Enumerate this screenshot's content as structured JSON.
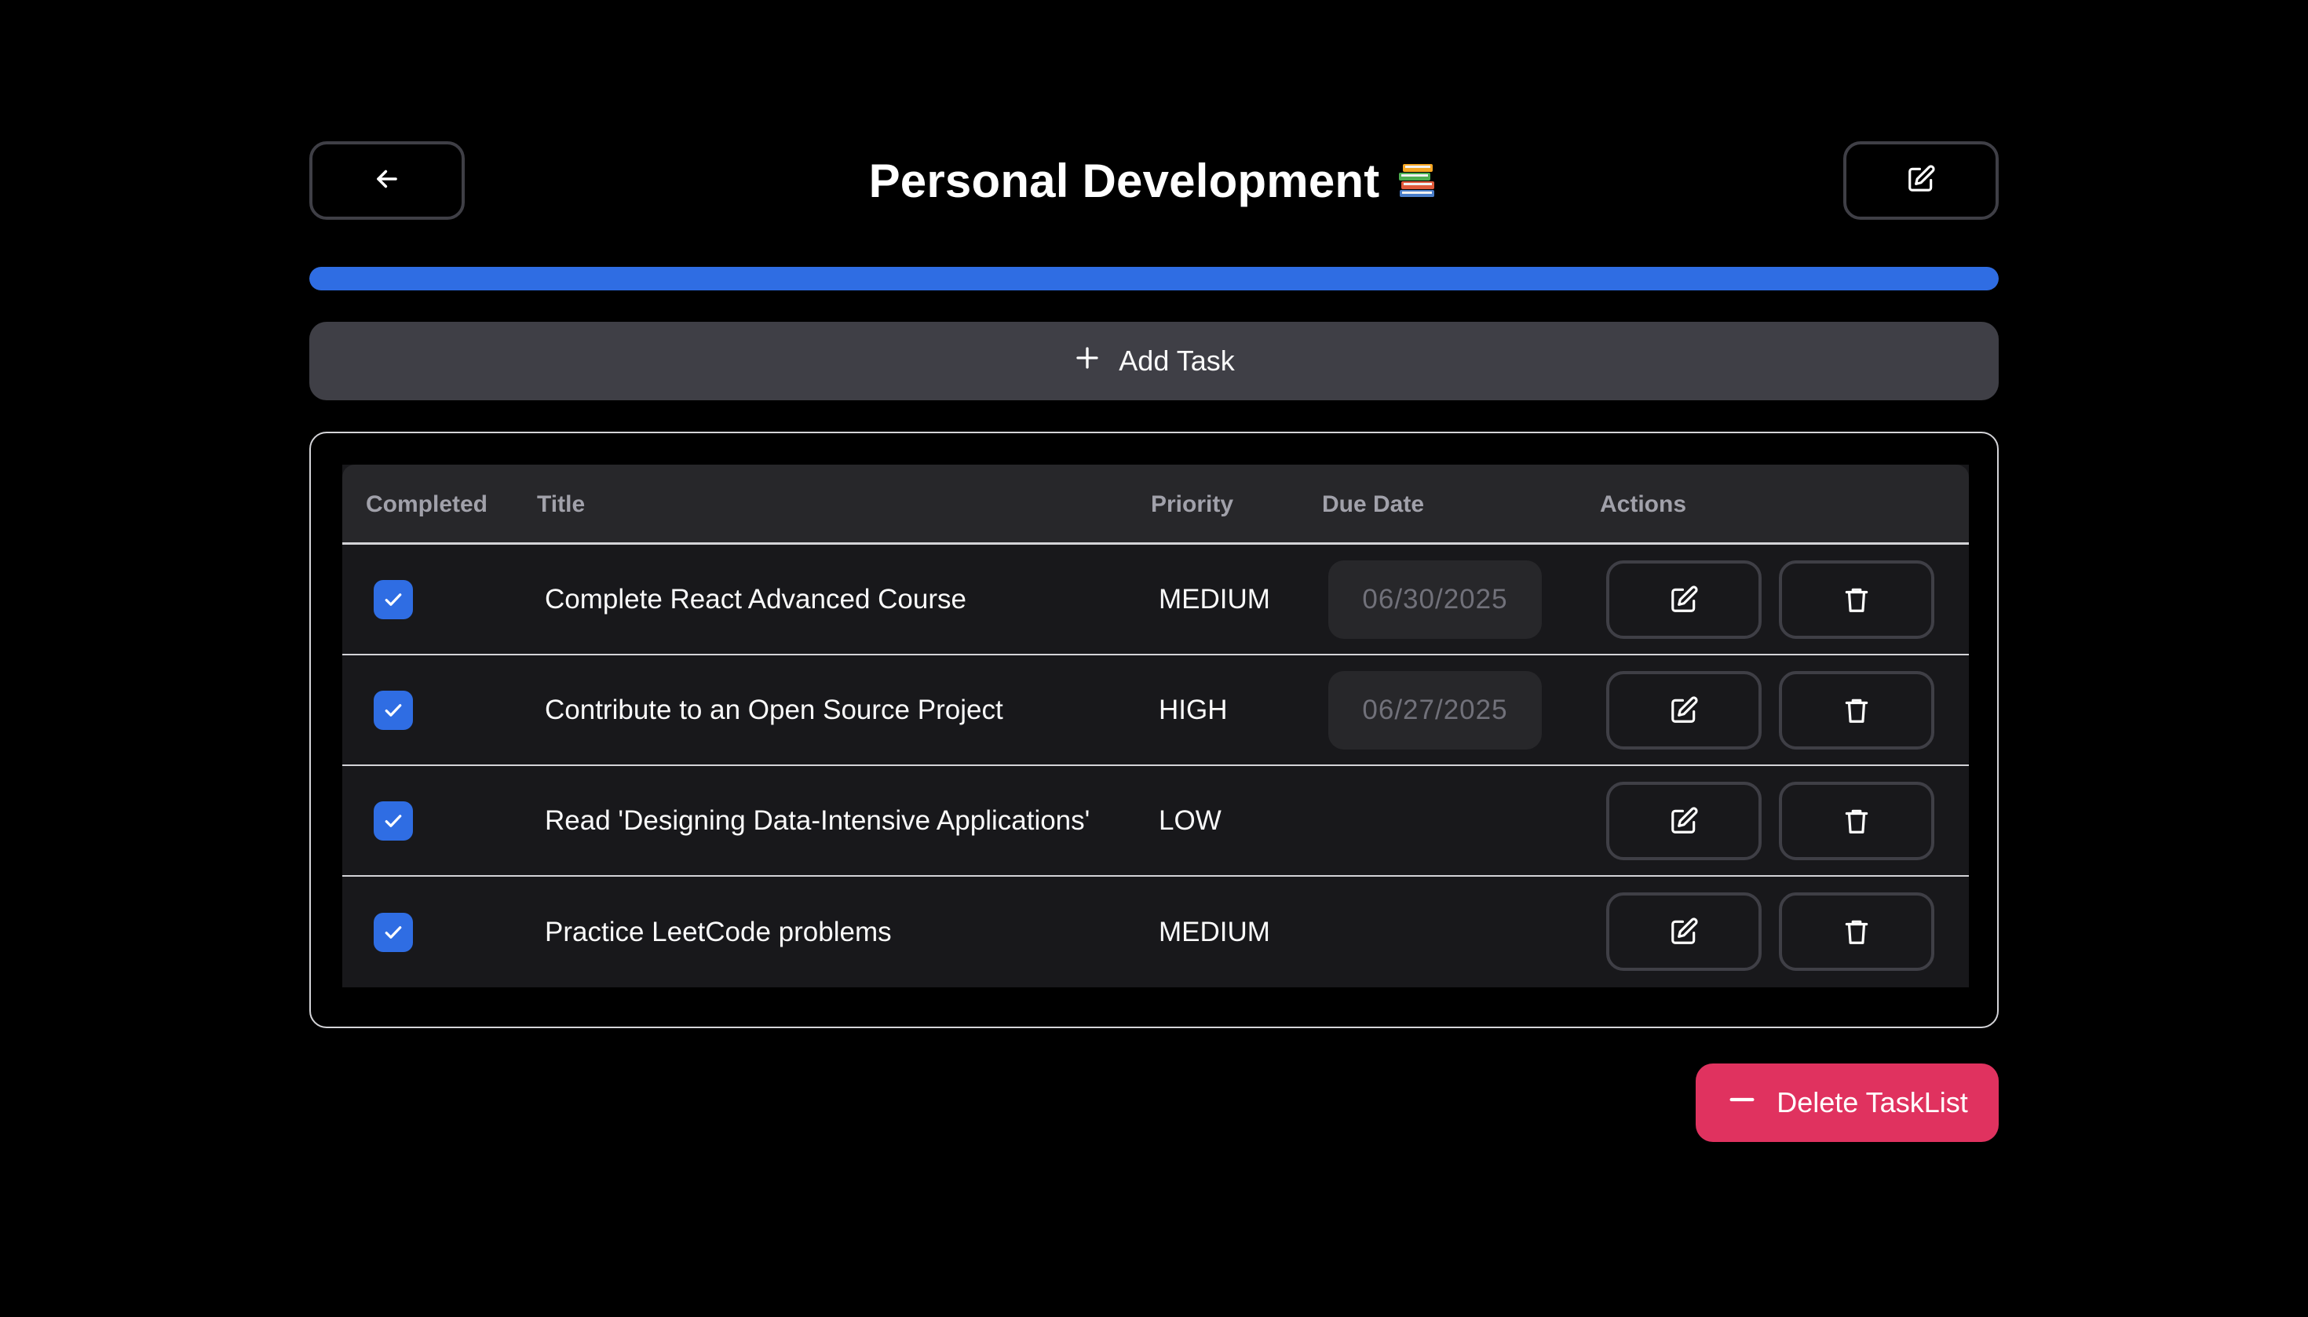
{
  "header": {
    "title": "Personal Development",
    "title_emoji": "books-emoji"
  },
  "progress": {
    "completed_fraction": 1.0,
    "color": "#2f6de3"
  },
  "add_task": {
    "label": "Add Task",
    "icon": "plus-icon"
  },
  "table": {
    "columns": [
      "Completed",
      "Title",
      "Priority",
      "Due Date",
      "Actions"
    ],
    "rows": [
      {
        "completed": true,
        "title": "Complete React Advanced Course",
        "priority": "MEDIUM",
        "due_date": "06/30/2025"
      },
      {
        "completed": true,
        "title": "Contribute to an Open Source Project",
        "priority": "HIGH",
        "due_date": "06/27/2025"
      },
      {
        "completed": true,
        "title": "Read 'Designing Data-Intensive Applications'",
        "priority": "LOW",
        "due_date": ""
      },
      {
        "completed": true,
        "title": "Practice LeetCode problems",
        "priority": "MEDIUM",
        "due_date": ""
      }
    ]
  },
  "delete_list": {
    "label": "Delete TaskList",
    "icon": "minus-icon",
    "color": "#e0325f"
  },
  "icons": {
    "back": "arrow-left-icon",
    "edit": "pencil-square-icon",
    "delete": "trash-icon",
    "check": "check-icon"
  }
}
